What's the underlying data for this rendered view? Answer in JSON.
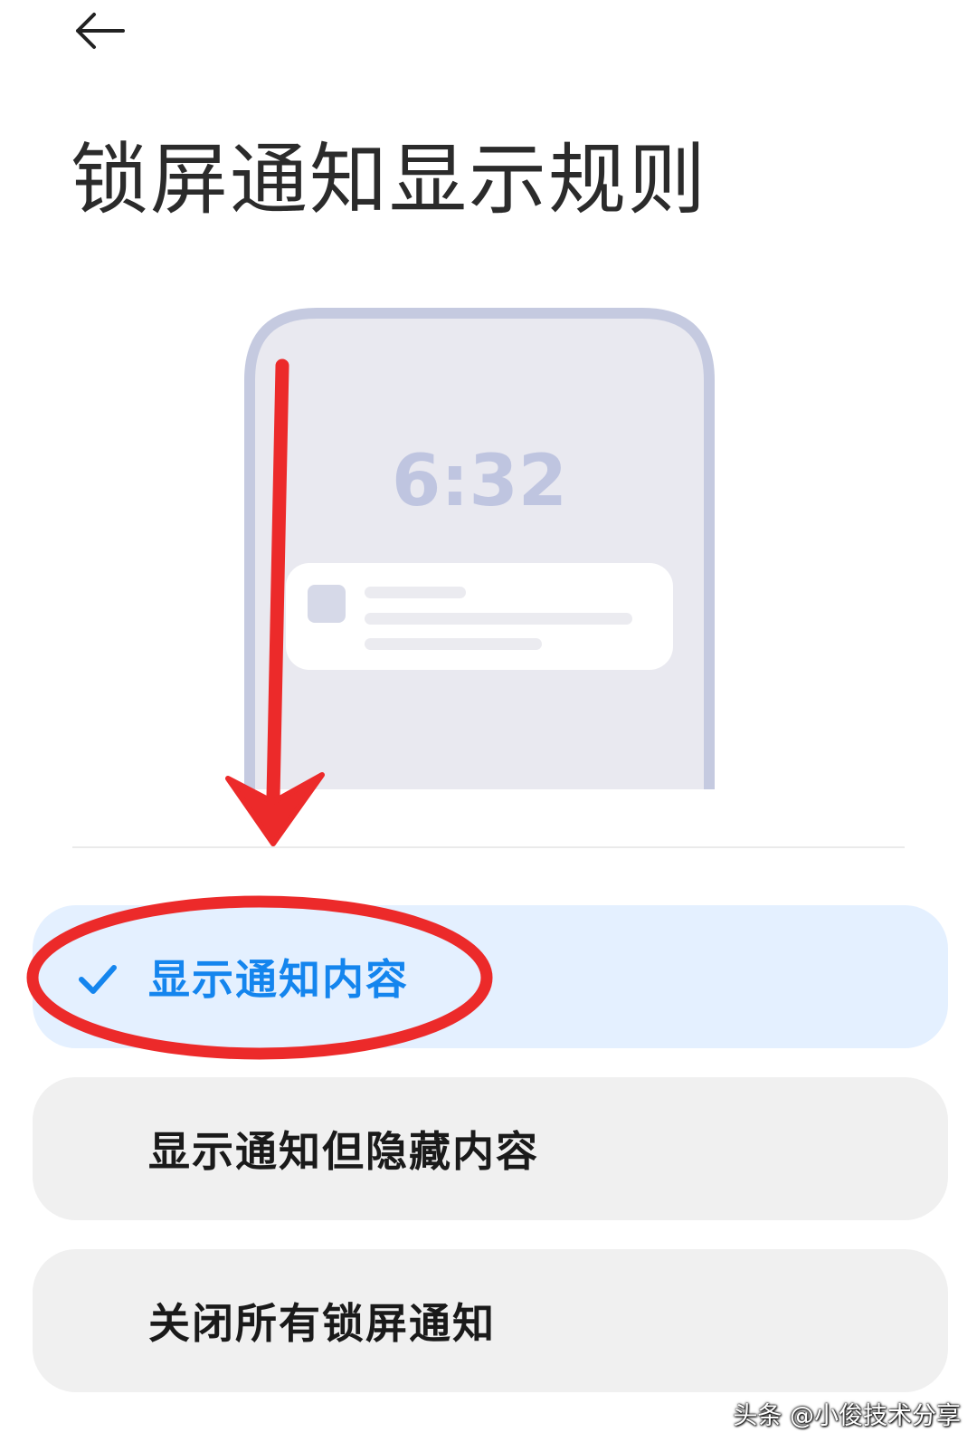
{
  "header": {
    "back_icon": "arrow-left-icon",
    "title": "锁屏通知显示规则"
  },
  "illustration": {
    "clock_time": "6:32",
    "colors": {
      "phone_frame": "#c5cae0",
      "phone_screen": "#e9e9f0",
      "clock_text": "#bfc5e0",
      "card": "#ffffff",
      "card_icon": "#d6d9e8",
      "card_line": "#ebebf0"
    }
  },
  "options": [
    {
      "label": "显示通知内容",
      "selected": true,
      "icon": "checkmark-icon"
    },
    {
      "label": "显示通知但隐藏内容",
      "selected": false
    },
    {
      "label": "关闭所有锁屏通知",
      "selected": false
    }
  ],
  "annotation": {
    "arrow_color": "#ec2a2a",
    "ellipse_color": "#ec2a2a"
  },
  "watermark": "头条 @小俊技术分享",
  "colors": {
    "accent": "#1485ee",
    "selected_bg": "#e4f0ff",
    "option_bg": "#f0f0f0",
    "title_text": "#2b2b2b"
  }
}
